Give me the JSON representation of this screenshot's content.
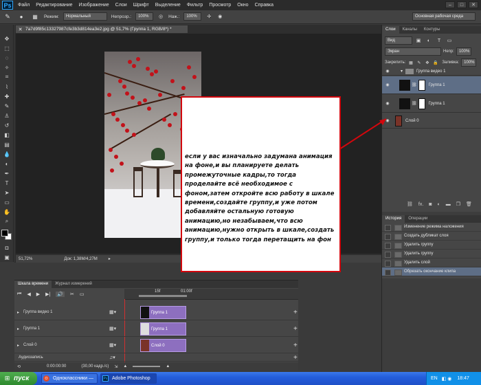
{
  "app": {
    "logo": "Ps"
  },
  "menu": [
    "Файл",
    "Редактирование",
    "Изображение",
    "Слои",
    "Шрифт",
    "Выделение",
    "Фильтр",
    "Просмотр",
    "Окно",
    "Справка"
  ],
  "options": {
    "mode_label": "Режим:",
    "mode_value": "Нормальный",
    "opacity_label": "Непрозр.:",
    "opacity_value": "100%",
    "pressure_label": "Наж.:",
    "pressure_value": "100%",
    "workspace": "Основная рабочая среда"
  },
  "document": {
    "tab_title": "7a7d9f85c13327987cfe3b3d814ea3e2.jpg @ 51,7% (Группа 1, RGB/8*) *",
    "zoom": "51,72%",
    "doc_size": "Док: 1,38M/4,27M"
  },
  "layers_panel": {
    "tabs": [
      "Слои",
      "Каналы",
      "Контуры"
    ],
    "kind_label": "Вид",
    "blend_mode": "Экран",
    "opacity_label": "Непр:",
    "opacity_value": "100%",
    "lock_label": "Закрепить:",
    "fill_label": "Заливка:",
    "fill_value": "100%",
    "layers": [
      {
        "name": "Группа видео 1"
      },
      {
        "name": "Группа 1"
      },
      {
        "name": "Группа 1"
      },
      {
        "name": "Слой 0"
      }
    ],
    "footer_fx": "fx."
  },
  "history_panel": {
    "tabs": [
      "История",
      "Операции"
    ],
    "items": [
      "Изменение режима наложения",
      "Создать дубликат слоя",
      "Удалить группу",
      "Удалить группу",
      "Удалить слой",
      "Обрезать окончание клипа"
    ]
  },
  "timeline": {
    "tabs": [
      "Шкала времени",
      "Журнал измерений"
    ],
    "ruler": [
      "15f",
      "01:00f"
    ],
    "tracks": [
      {
        "name": "Группа видео 1",
        "clip": "Группа 1"
      },
      {
        "name": "Группа 1",
        "clip": "Группа 1"
      },
      {
        "name": "Слой 0",
        "clip": "Слой 0"
      }
    ],
    "audio_label": "Аудиозапись",
    "timecode": "0:00:00:00",
    "fps": "(30,00 кадр./с)"
  },
  "callout": {
    "text": "если у вас изначально задумана анимация на фоне,и вы планируете делать промежуточные кадры,то тогда проделайте всё необходимое с фоном,затем откройте всю работу  в  шкале времени,создайте группу,и уже потом добавляйте остальную готовую анимацию,но незабываем,что всю анимацию,нужно открыть в шкале,создать группу,и только тогда перетащить на фон"
  },
  "taskbar": {
    "start": "пуск",
    "items": [
      "Одноклассники — О...",
      "Adobe Photoshop CS6"
    ],
    "lang": "EN",
    "clock": "18:47"
  },
  "colors": {
    "accent_red": "#d3070d",
    "clip_purple": "#8d6fbf"
  }
}
